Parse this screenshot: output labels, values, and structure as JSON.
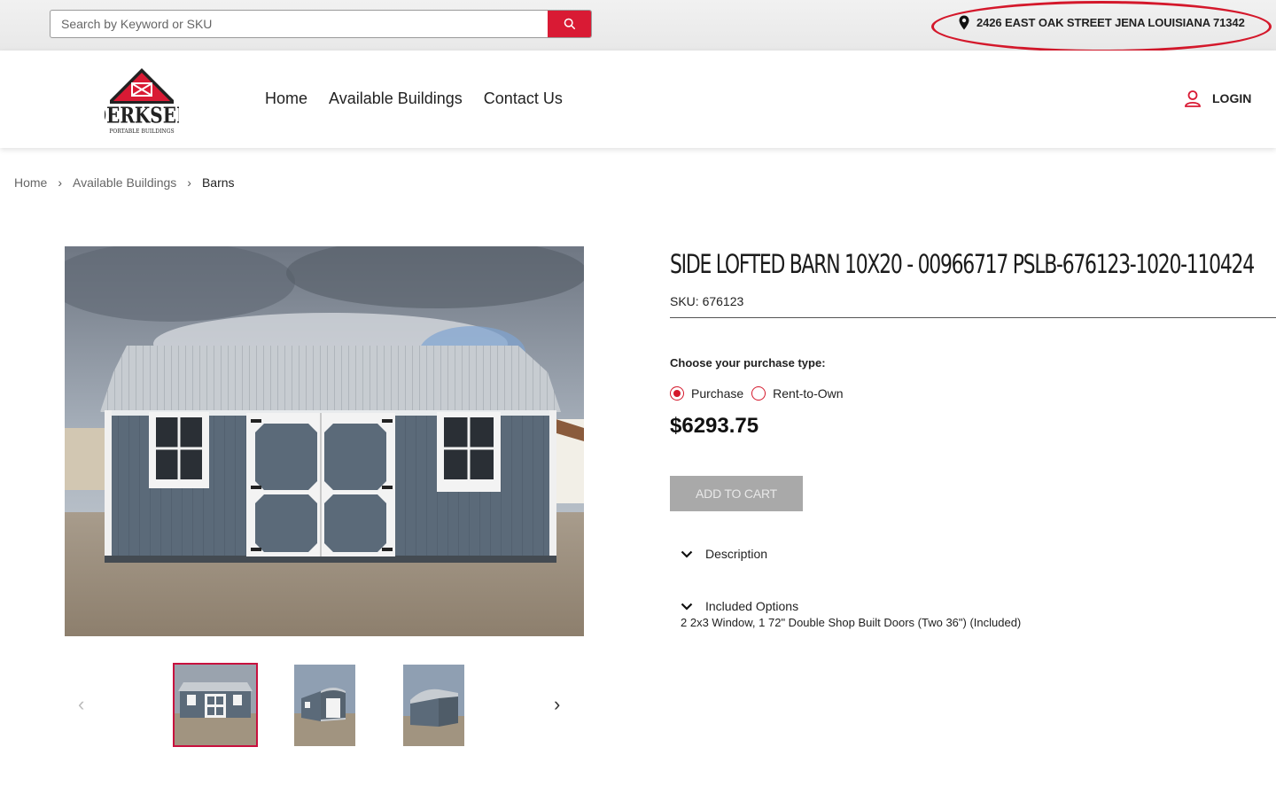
{
  "search": {
    "placeholder": "Search by Keyword or SKU"
  },
  "address": "2426 EAST OAK STREET JENA LOUISIANA 71342",
  "logo": {
    "name": "DERKSEN",
    "tagline": "PORTABLE BUILDINGS"
  },
  "nav": {
    "items": [
      "Home",
      "Available Buildings",
      "Contact Us"
    ]
  },
  "login_label": "LOGIN",
  "breadcrumb": [
    "Home",
    "Available Buildings",
    "Barns"
  ],
  "product": {
    "title": "SIDE LOFTED BARN 10X20 - 00966717 PSLB-676123-1020-110424",
    "sku_label": "SKU:",
    "sku": "676123",
    "purchase_type_label": "Choose your purchase type:",
    "options": [
      "Purchase",
      "Rent-to-Own"
    ],
    "selected_option": "Purchase",
    "price": "$6293.75",
    "add_to_cart": "ADD TO CART",
    "description_label": "Description",
    "included_options_label": "Included Options",
    "included_options_text": "2 2x3 Window, 1 72\" Double Shop Built Doors (Two 36\") (Included)"
  },
  "gallery": {
    "thumbnail_count": 3,
    "active_index": 0
  },
  "colors": {
    "accent": "#d91a34",
    "button_disabled": "#a9a9a9",
    "building": "#5a6a79",
    "trim": "#ffffff"
  }
}
